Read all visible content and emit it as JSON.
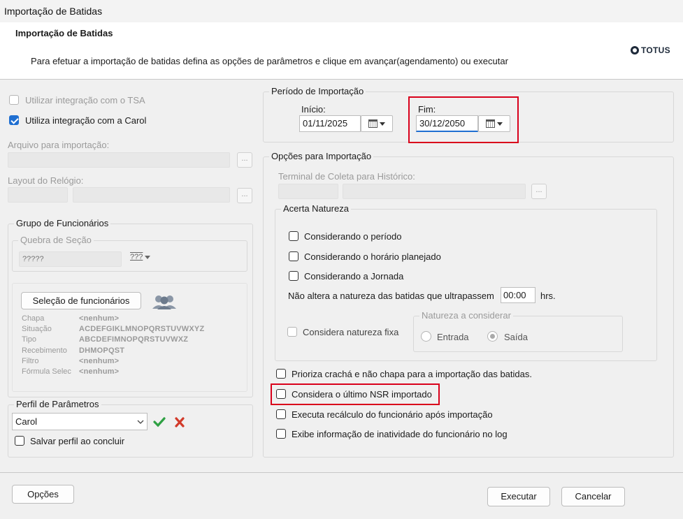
{
  "window": {
    "title": "Importação de Batidas"
  },
  "header": {
    "title": "Importação de Batidas",
    "subtitle": "Para efetuar a importação de batidas defina as opções de parâmetros e clique em avançar(agendamento) ou executar",
    "logo_text": "TOTUS"
  },
  "left": {
    "tsa_label": "Utilizar integração com o TSA",
    "tsa_checked": false,
    "carol_label": "Utiliza integração com a Carol",
    "carol_checked": true,
    "arquivo_label": "Arquivo para importação:",
    "layout_label": "Layout do Relógio:",
    "browse_label": "...",
    "grupo": {
      "legend": "Grupo de Funcionários",
      "quebra_legend": "Quebra de Seção",
      "quebra_value": "?????",
      "quebra_btn": "???",
      "selecao_button": "Seleção de funcionários",
      "details": [
        {
          "key": "Chapa",
          "value": "<nenhum>"
        },
        {
          "key": "Situação",
          "value": "ACDEFGIKLMNOPQRSTUVWXYZ"
        },
        {
          "key": "Tipo",
          "value": "ABCDEFIMNOPQRSTUVWXZ"
        },
        {
          "key": "Recebimento",
          "value": "DHMOPQST"
        },
        {
          "key": "Filtro",
          "value": "<nenhum>"
        },
        {
          "key": "Fórmula Selec",
          "value": "<nenhum>"
        }
      ]
    },
    "perfil": {
      "legend": "Perfil de Parâmetros",
      "value": "Carol",
      "salvar_label": "Salvar perfil ao concluir"
    }
  },
  "periodo": {
    "legend": "Período de Importação",
    "inicio_label": "Início:",
    "inicio_value": "01/11/2025",
    "fim_label": "Fim:",
    "fim_value": "30/12/2050"
  },
  "opcoes": {
    "legend": "Opções para Importação",
    "terminal_label": "Terminal de Coleta para Histórico:",
    "acerta": {
      "legend": "Acerta Natureza",
      "items": [
        "Considerando o período",
        "Considerando o horário planejado",
        "Considerando a Jornada"
      ],
      "nao_altera_label": "Não altera a natureza das batidas que ultrapassem",
      "nao_altera_value": "00:00",
      "hrs_label": "hrs.",
      "fixa_label": "Considera natureza fixa",
      "natureza_legend": "Natureza a considerar",
      "entrada_label": "Entrada",
      "saida_label": "Saída",
      "selected": "Saída"
    },
    "checks": [
      "Prioriza crachá e não chapa para a importação das batidas.",
      "Considera o último NSR importado",
      "Executa recálculo do funcionário após importação",
      "Exibe informação de inatividade do funcionário no log"
    ]
  },
  "footer": {
    "opcoes_button": "Opções",
    "executar_button": "Executar",
    "cancelar_button": "Cancelar"
  },
  "colors": {
    "accent": "#1f6fd1",
    "highlight": "#d9001b",
    "check_green": "#2ea043",
    "cross_red": "#d23a2a"
  }
}
